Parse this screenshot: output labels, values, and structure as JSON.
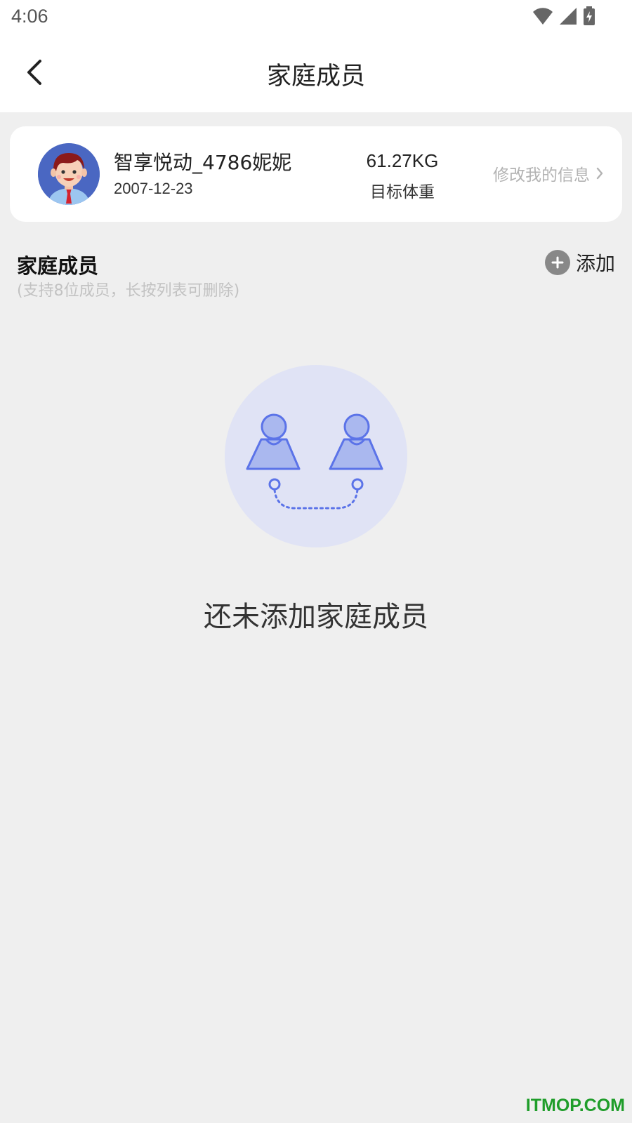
{
  "status_bar": {
    "time": "4:06"
  },
  "header": {
    "title": "家庭成员"
  },
  "profile": {
    "name": "智享悦动_4786妮妮",
    "birthday": "2007-12-23",
    "target_weight": "61.27KG",
    "target_weight_label": "目标体重",
    "edit_label": "修改我的信息"
  },
  "family_section": {
    "title": "家庭成员",
    "subtitle": "(支持8位成员，长按列表可删除)",
    "add_label": "添加"
  },
  "empty_state": {
    "message": "还未添加家庭成员"
  },
  "watermark": "ITMOP.COM",
  "colors": {
    "accent": "#5b73e8",
    "illustration_bg": "#e0e3f5",
    "page_bg": "#efefef",
    "watermark": "#1f9d2a"
  },
  "icons": [
    "back-arrow-icon",
    "wifi-icon",
    "signal-icon",
    "battery-icon",
    "avatar-icon",
    "chevron-right-icon",
    "plus-icon",
    "family-members-icon"
  ]
}
